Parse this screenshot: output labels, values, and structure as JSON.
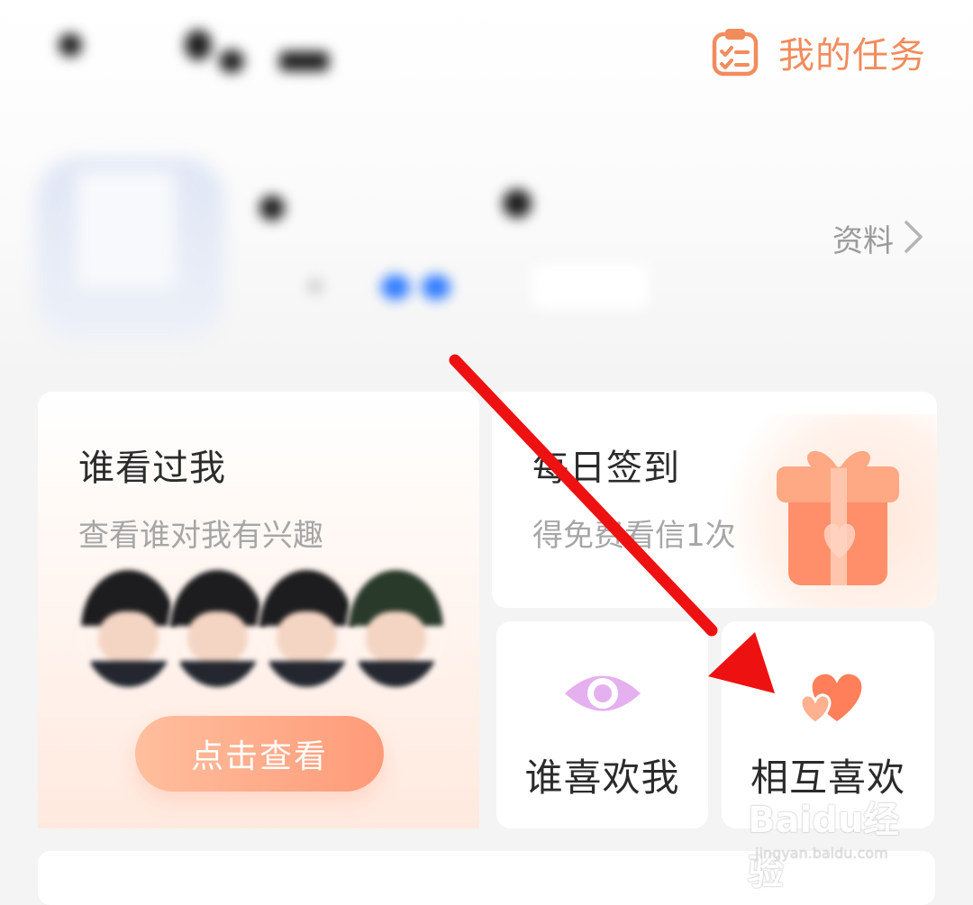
{
  "header": {
    "task_icon": "task-list-icon",
    "task_label": "我的任务"
  },
  "profile": {
    "link_label": "资料",
    "link_icon": "chevron-right-icon"
  },
  "cards": {
    "visitors": {
      "title": "谁看过我",
      "subtitle": "查看谁对我有兴趣",
      "button_label": "点击查看"
    },
    "checkin": {
      "title": "每日签到",
      "subtitle": "得免费看信1次",
      "icon": "gift-box-icon"
    },
    "likes_me": {
      "label": "谁喜欢我",
      "icon": "eye-icon"
    },
    "mutual": {
      "label": "相互喜欢",
      "icon": "double-heart-icon"
    }
  },
  "watermark": {
    "brand": "Baidu经验",
    "url": "jingyan.baidu.com"
  },
  "colors": {
    "accent": "#f28c5c",
    "button_gradient_start": "#ffbf9e",
    "button_gradient_end": "#ff9a78",
    "eye_icon": "#e8b4f0",
    "heart_icon": "#ff7f5a",
    "arrow": "#ee1111"
  }
}
